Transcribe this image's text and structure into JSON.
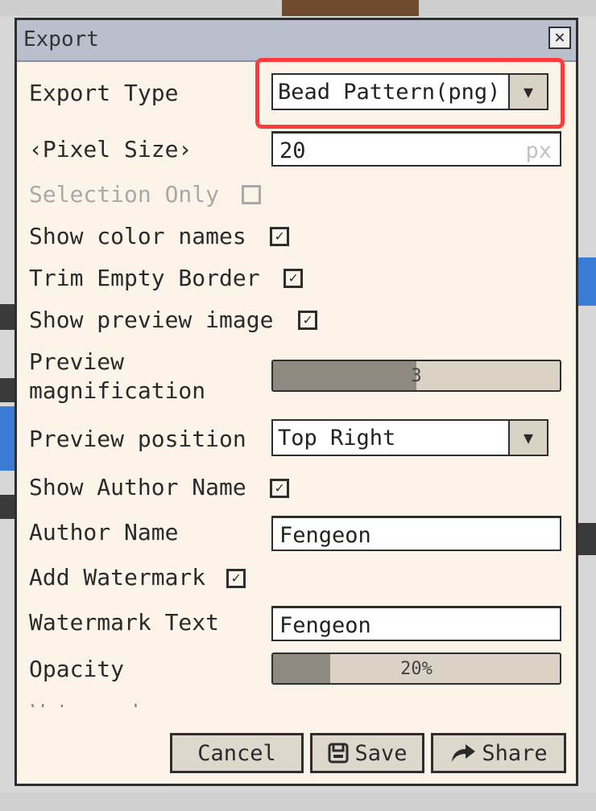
{
  "dialog": {
    "title": "Export",
    "close_glyph": "✕",
    "export_type": {
      "label": "Export Type",
      "value": "Bead Pattern(png)"
    },
    "pixel_size": {
      "label": "‹Pixel Size›",
      "value": "20",
      "unit": "px"
    },
    "selection_only": {
      "label": "Selection Only",
      "checked": false,
      "enabled": false
    },
    "show_color_names": {
      "label": "Show color names",
      "checked": true
    },
    "trim_empty_border": {
      "label": "Trim Empty Border",
      "checked": true
    },
    "show_preview_image": {
      "label": "Show preview image",
      "checked": true
    },
    "preview_magnification": {
      "label_line1": "Preview",
      "label_line2": "magnification",
      "value_text": "3",
      "level": 0.5
    },
    "preview_position": {
      "label": "Preview position",
      "value": "Top Right"
    },
    "show_author_name": {
      "label": "Show Author Name",
      "checked": true
    },
    "author_name": {
      "label": "Author Name",
      "value": "Fengeon"
    },
    "add_watermark": {
      "label": "Add Watermark",
      "checked": true
    },
    "watermark_text": {
      "label": "Watermark Text",
      "value": "Fengeon"
    },
    "opacity": {
      "label": "Opacity",
      "value_text": "20%",
      "level": 0.2
    },
    "truncated_label": "Watermark",
    "buttons": {
      "cancel": "Cancel",
      "save": "Save",
      "share": "Share"
    }
  },
  "icons": {
    "dropdown": "dropdown-arrow-icon",
    "save": "floppy-disk-icon",
    "share": "share-arrow-icon",
    "check": "check-icon"
  },
  "colors": {
    "dialog_bg": "#fdf4e9",
    "titlebar": "#b9bfcc",
    "highlight": "#ff3b3b",
    "button_bg": "#ddd7cc",
    "slider_fill": "#8e8a80"
  }
}
